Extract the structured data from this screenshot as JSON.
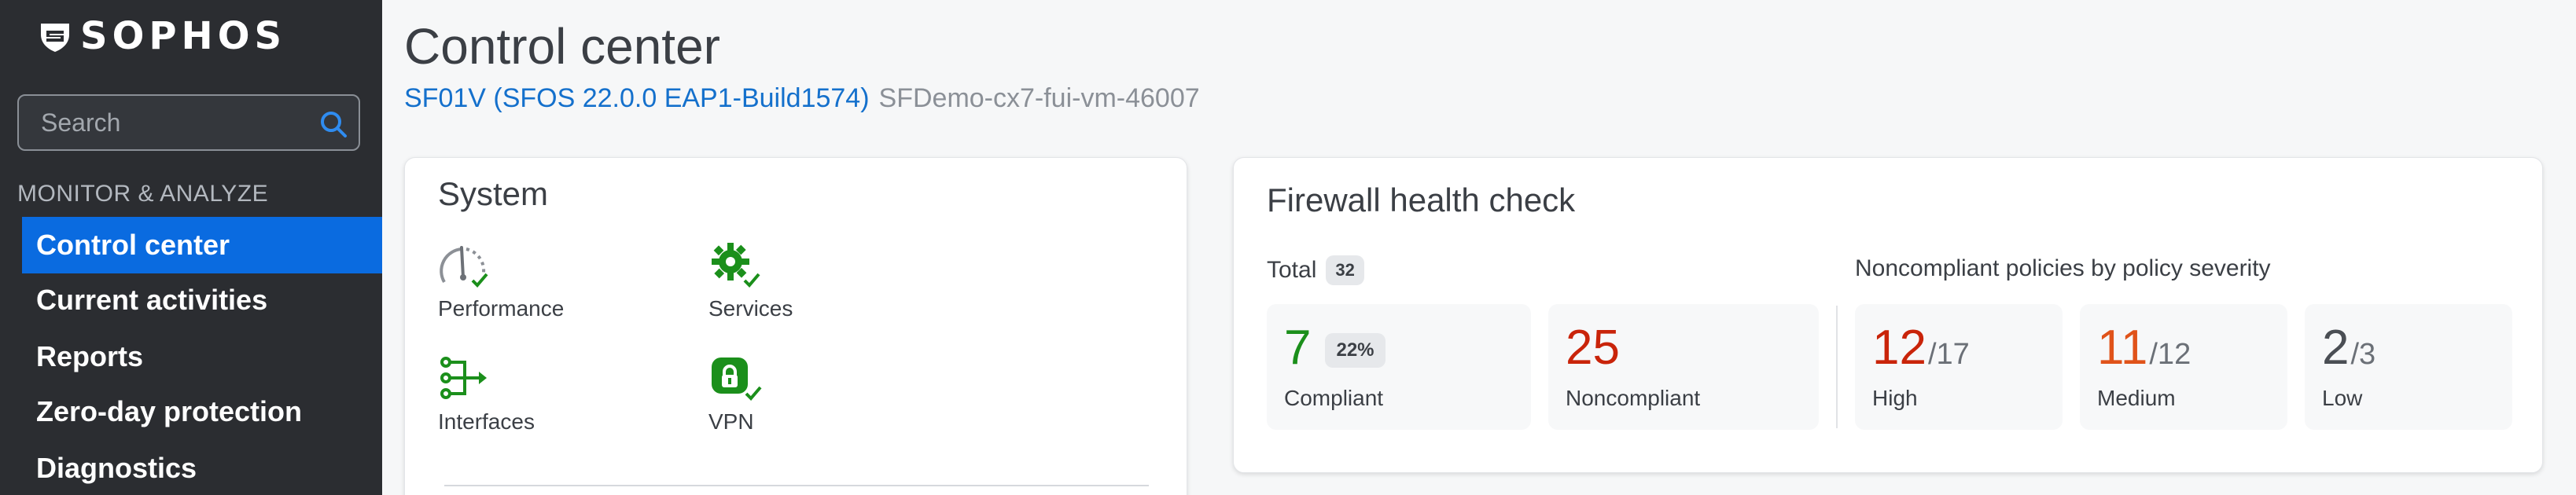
{
  "brand": {
    "logo_text": "SOPHOS"
  },
  "sidebar": {
    "search": {
      "placeholder": "Search"
    },
    "section_label": "MONITOR & ANALYZE",
    "items": [
      {
        "label": "Control center",
        "active": true
      },
      {
        "label": "Current activities",
        "active": false
      },
      {
        "label": "Reports",
        "active": false
      },
      {
        "label": "Zero-day protection",
        "active": false
      },
      {
        "label": "Diagnostics",
        "active": false
      }
    ]
  },
  "header": {
    "title": "Control center",
    "device": "SF01V (SFOS 22.0.0 EAP1-Build1574)",
    "hostname": "SFDemo-cx7-fui-vm-46007"
  },
  "system_card": {
    "title": "System",
    "items": [
      {
        "label": "Performance",
        "icon": "performance-gauge-icon"
      },
      {
        "label": "Services",
        "icon": "services-gear-check-icon"
      },
      {
        "label": "Interfaces",
        "icon": "interfaces-icon"
      },
      {
        "label": "VPN",
        "icon": "vpn-lock-check-icon"
      }
    ]
  },
  "health_card": {
    "title": "Firewall health check",
    "total_label": "Total",
    "total_count": "32",
    "severity_title": "Noncompliant policies by policy severity",
    "compliant": {
      "value": "7",
      "percent": "22%",
      "label": "Compliant"
    },
    "noncompliant": {
      "value": "25",
      "label": "Noncompliant"
    },
    "high": {
      "value": "12",
      "total": "/17",
      "label": "High"
    },
    "medium": {
      "value": "11",
      "total": "/12",
      "label": "Medium"
    },
    "low": {
      "value": "2",
      "total": "/3",
      "label": "Low"
    }
  },
  "colors": {
    "sidebar_bg": "#2b2d31",
    "active_nav": "#0a6be0",
    "link_blue": "#1470cc",
    "success_green": "#1b8f1b",
    "high_red": "#c9240a",
    "medium_orange": "#e0531a",
    "low_gray": "#4a4e54"
  }
}
